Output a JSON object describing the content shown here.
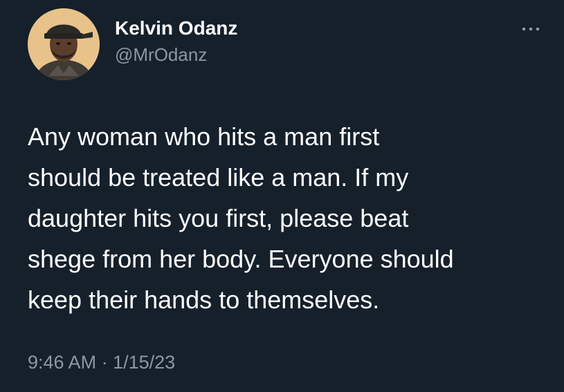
{
  "tweet": {
    "author": {
      "display_name": "Kelvin Odanz",
      "handle": "@MrOdanz",
      "avatar_icon": "profile-photo"
    },
    "more_icon": "more-horizontal-icon",
    "text": "Any woman who hits a man first\nshould be treated like a man. If my\ndaughter hits you first, please beat\nshege from her body. Everyone should\nkeep their hands to themselves.",
    "timestamp": "9:46 AM · 1/15/23"
  },
  "colors": {
    "background": "#15202b",
    "primary_text": "#ffffff",
    "secondary_text": "#8b98a5",
    "avatar_background": "#e7c38a"
  }
}
